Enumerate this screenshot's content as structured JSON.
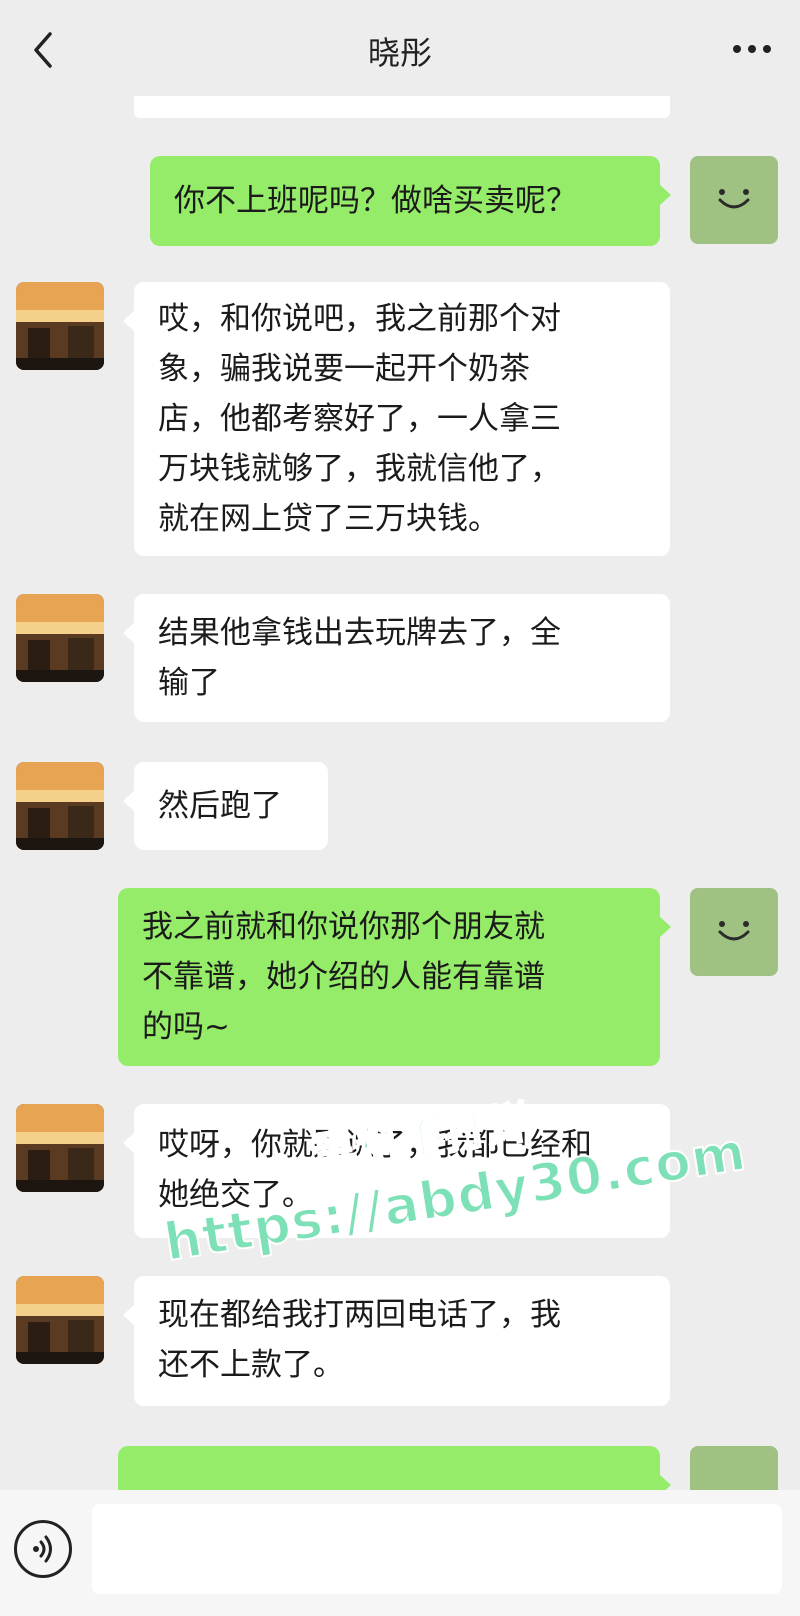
{
  "header": {
    "title": "晓彤"
  },
  "messages": [
    {
      "side": "out",
      "text": "你不上班呢吗？做啥买卖呢？"
    },
    {
      "side": "in",
      "text": "哎，和你说吧，我之前那个对\n象，骗我说要一起开个奶茶\n店，他都考察好了，一人拿三\n万块钱就够了，我就信他了，\n就在网上贷了三万块钱。"
    },
    {
      "side": "in",
      "text": "结果他拿钱出去玩牌去了，全\n输了"
    },
    {
      "side": "in",
      "text": "然后跑了"
    },
    {
      "side": "out",
      "text": "我之前就和你说你那个朋友就\n不靠谱，她介绍的人能有靠谱\n的吗~"
    },
    {
      "side": "in",
      "text": "哎呀，你就别说了，我都已经和\n她绝交了。"
    },
    {
      "side": "in",
      "text": "现在都给我打两回电话了，我\n还不上款了。"
    }
  ],
  "watermark": {
    "line1": "黑料不打烊",
    "line2": "https://abdy30.com"
  },
  "colors": {
    "background": "#ededed",
    "incoming_bubble": "#ffffff",
    "outgoing_bubble": "#95ec69",
    "self_avatar": "#9fc283"
  },
  "icons": {
    "back": "chevron-left-icon",
    "more": "ellipsis-icon",
    "voice": "voice-icon"
  }
}
